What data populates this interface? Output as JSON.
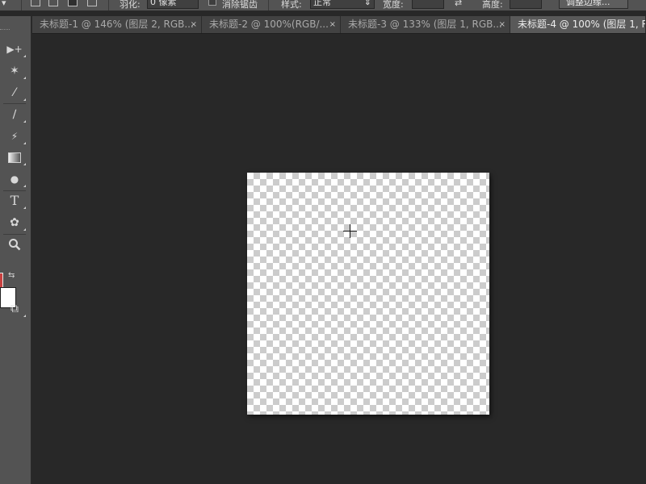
{
  "options_bar": {
    "feather_label": "羽化:",
    "feather_value": "0 像素",
    "antialias_label": "消除锯齿",
    "style_label": "样式:",
    "style_value": "正常",
    "width_label": "宽度:",
    "height_label": "高度:",
    "refine_edge_button": "调整边缘..."
  },
  "tabs": [
    {
      "label": "未标题-1 @ 146% (图层 2, RGB...",
      "close": "×",
      "active": false
    },
    {
      "label": "未标题-2 @ 100%(RGB/...",
      "close": "×",
      "active": false
    },
    {
      "label": "未标题-3 @ 133% (图层 1, RGB...",
      "close": "×",
      "active": false
    },
    {
      "label": "未标题-4 @ 100% (图层 1, R",
      "close": "×",
      "active": true
    }
  ],
  "toolbar": {
    "tools": [
      {
        "name": "move-tool",
        "icon": "move-icon",
        "glyph": "▶+"
      },
      {
        "name": "magic-wand-tool",
        "icon": "magic-wand-icon",
        "glyph": "✶"
      },
      {
        "name": "eyedropper-tool",
        "icon": "eyedropper-icon",
        "glyph": "⁄"
      },
      {
        "name": "brush-tool",
        "icon": "brush-icon",
        "glyph": "∕"
      },
      {
        "name": "history-brush-tool",
        "icon": "history-brush-icon",
        "glyph": "⚡"
      },
      {
        "name": "gradient-tool",
        "icon": "gradient-icon",
        "glyph": "▭"
      },
      {
        "name": "dodge-tool",
        "icon": "dodge-icon",
        "glyph": "●"
      },
      {
        "name": "text-tool",
        "icon": "type-icon",
        "glyph": "T"
      },
      {
        "name": "shape-tool",
        "icon": "custom-shape-icon",
        "glyph": "✿"
      },
      {
        "name": "zoom-tool",
        "icon": "zoom-icon",
        "glyph": "🔍"
      }
    ],
    "swap_glyph": "⇆",
    "screen_mode_glyph": "⧉"
  },
  "colors": {
    "foreground": "#c8403f",
    "background": "#ffffff",
    "workspace": "#282828",
    "panel": "#535353"
  },
  "document": {
    "transparent_canvas": true
  }
}
